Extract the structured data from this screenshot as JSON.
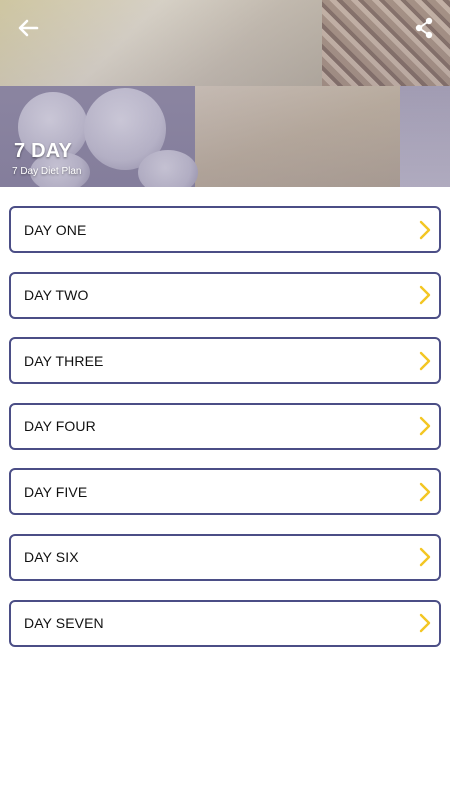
{
  "header": {
    "title": "7 DAY",
    "subtitle": "7 Day Diet Plan",
    "icons": {
      "back": "arrow-left-icon",
      "share": "share-icon"
    }
  },
  "days": [
    {
      "label": "DAY ONE"
    },
    {
      "label": "DAY TWO"
    },
    {
      "label": "DAY THREE"
    },
    {
      "label": "DAY FOUR"
    },
    {
      "label": "DAY FIVE"
    },
    {
      "label": "DAY SIX"
    },
    {
      "label": "DAY SEVEN"
    }
  ],
  "colors": {
    "item_border": "#4b4e86",
    "chevron": "#f3c623",
    "header_text": "#ffffff"
  }
}
